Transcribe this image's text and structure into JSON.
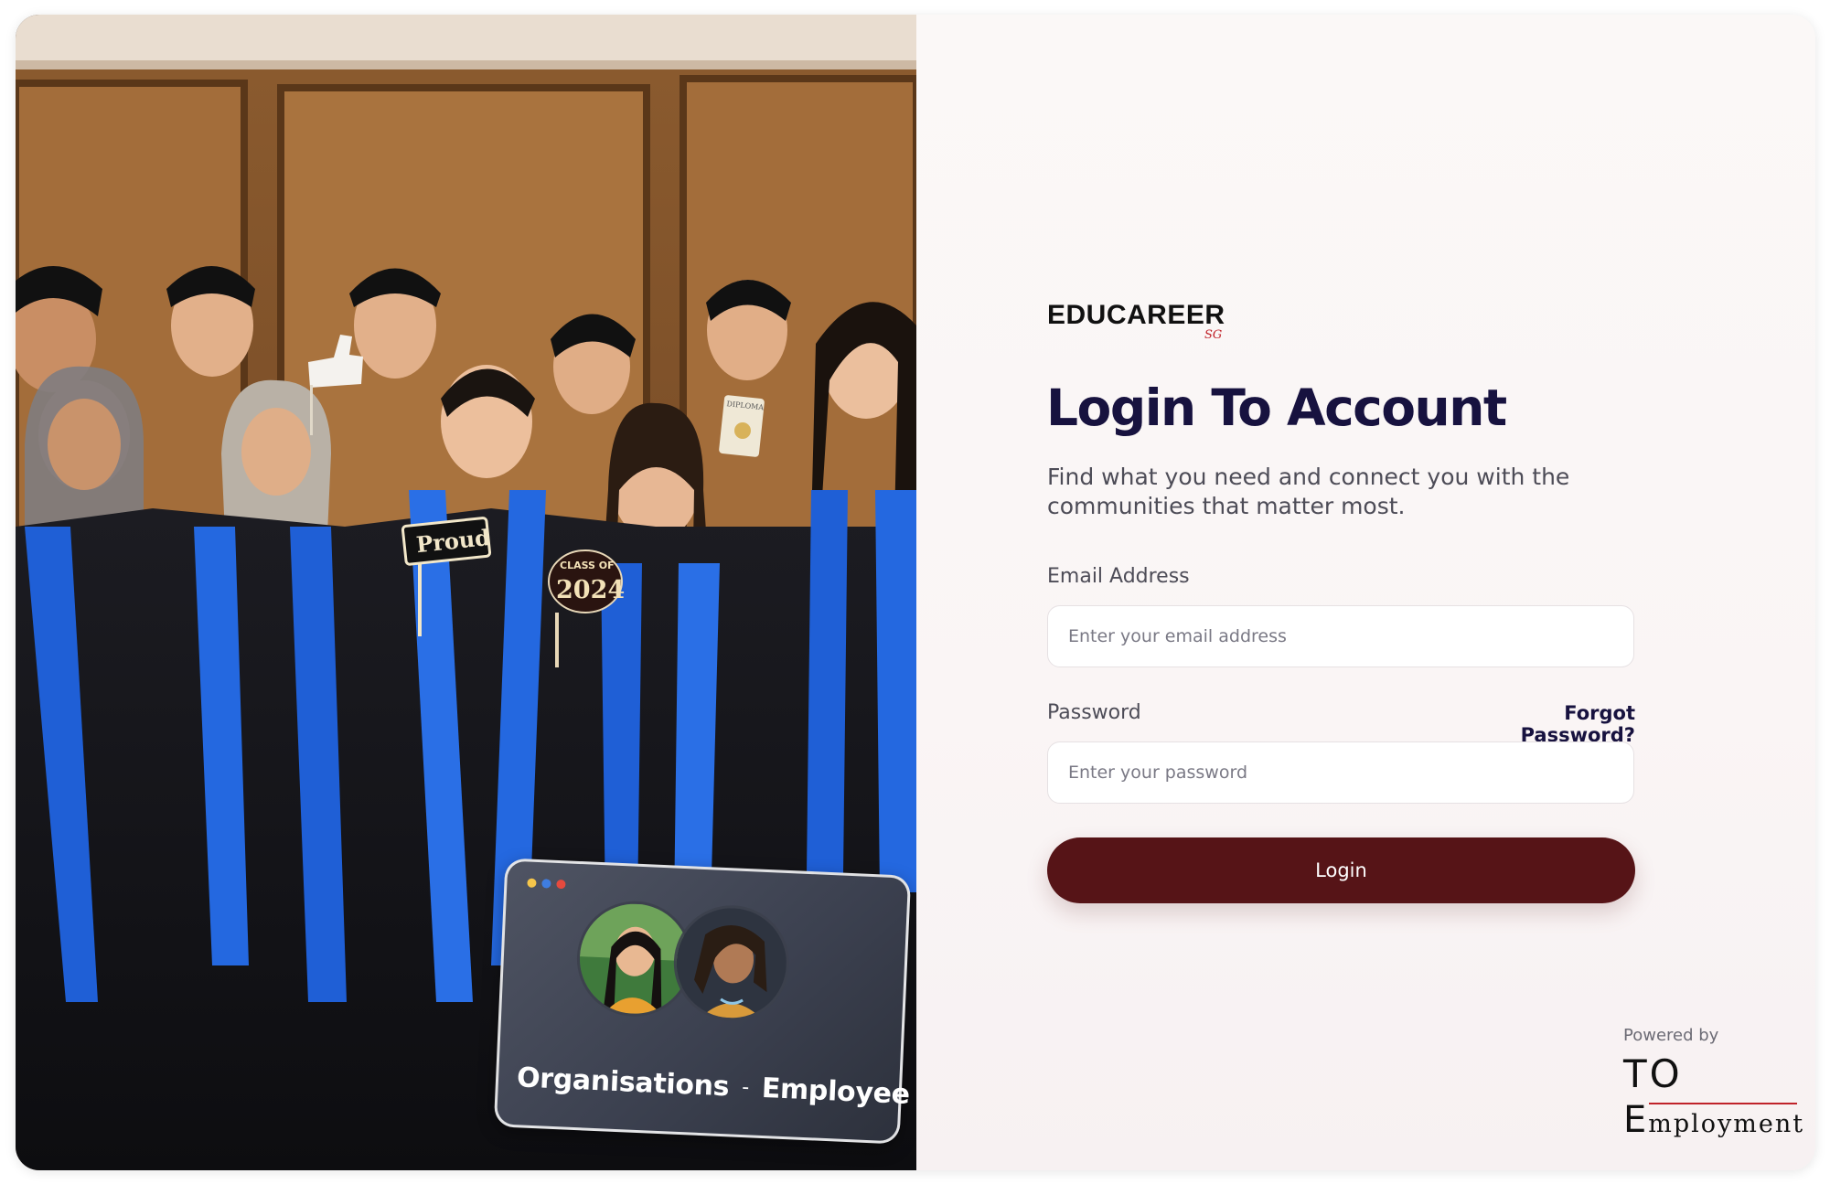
{
  "photo_panel": {
    "props": {
      "proud_sign": "Proud",
      "class_of_sign": "CLASS OF",
      "class_year": "2024",
      "diploma_scroll": "DIPLOMA"
    },
    "card": {
      "window_dot_colors": [
        "#f5c64b",
        "#3f7de0",
        "#e54a3e"
      ],
      "caption_left": "Organisations",
      "caption_separator": "-",
      "caption_right": "Employee"
    }
  },
  "login_panel": {
    "brand": "EDUCAREER",
    "brand_sub": "SG",
    "title": "Login To Account",
    "subtitle": "Find what you need and connect you with the communities that matter most.",
    "email": {
      "label": "Email Address",
      "placeholder": "Enter your email address",
      "value": ""
    },
    "password": {
      "label": "Password",
      "placeholder": "Enter your password",
      "value": ""
    },
    "forgot_password": "Forgot Password?",
    "login_button": "Login",
    "footer": {
      "powered_by": "Powered by",
      "logo_line1": "TO",
      "logo_line2_initial": "E",
      "logo_line2_rest": "mployment"
    }
  },
  "colors": {
    "brand_dark": "#17123f",
    "button": "#561417",
    "accent_red": "#c0232a",
    "gown_blue": "#1f5fd6"
  }
}
